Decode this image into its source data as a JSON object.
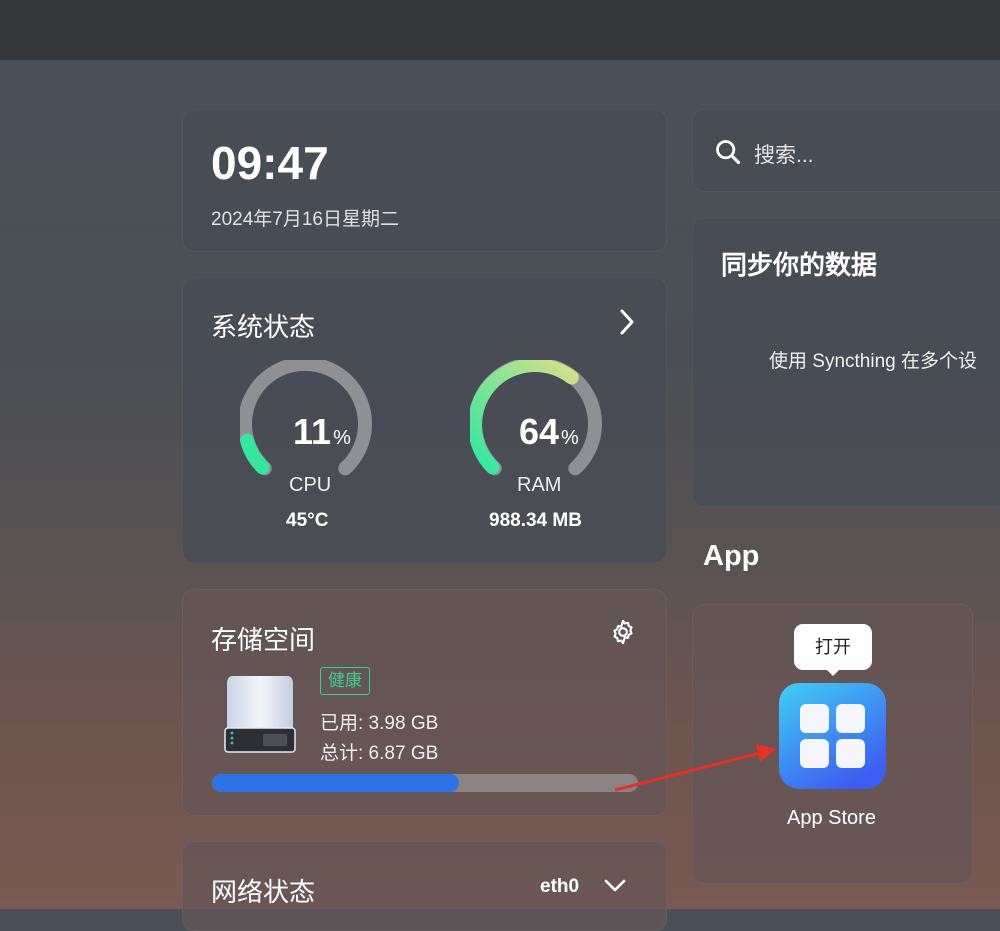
{
  "clock": {
    "time": "09:47",
    "date": "2024年7月16日星期二"
  },
  "system": {
    "title": "系统状态",
    "cpu": {
      "value": "11",
      "percent": 11,
      "unit": "%",
      "label": "CPU",
      "detail": "45°C"
    },
    "ram": {
      "value": "64",
      "percent": 64,
      "unit": "%",
      "label": "RAM",
      "detail": "988.34 MB"
    },
    "arrow_icon": "chevron-right-icon"
  },
  "storage": {
    "title": "存储空间",
    "status": "健康",
    "used": "已用: 3.98 GB",
    "total": "总计: 6.87 GB",
    "used_fraction": 0.58,
    "settings_icon": "gear-icon"
  },
  "network": {
    "title": "网络状态",
    "interface": "eth0"
  },
  "search": {
    "placeholder": "搜索..."
  },
  "syncthing": {
    "title": "同步你的数据",
    "description": "使用 Syncthing 在多个设"
  },
  "apps": {
    "heading": "App",
    "items": [
      {
        "name": "App Store",
        "tooltip": "打开"
      }
    ]
  },
  "colors": {
    "accent_blue": "#2f74e6",
    "healthy_green": "#3ecf8e",
    "gauge_track": "#8e9096",
    "annotation_red": "#e8302a"
  }
}
